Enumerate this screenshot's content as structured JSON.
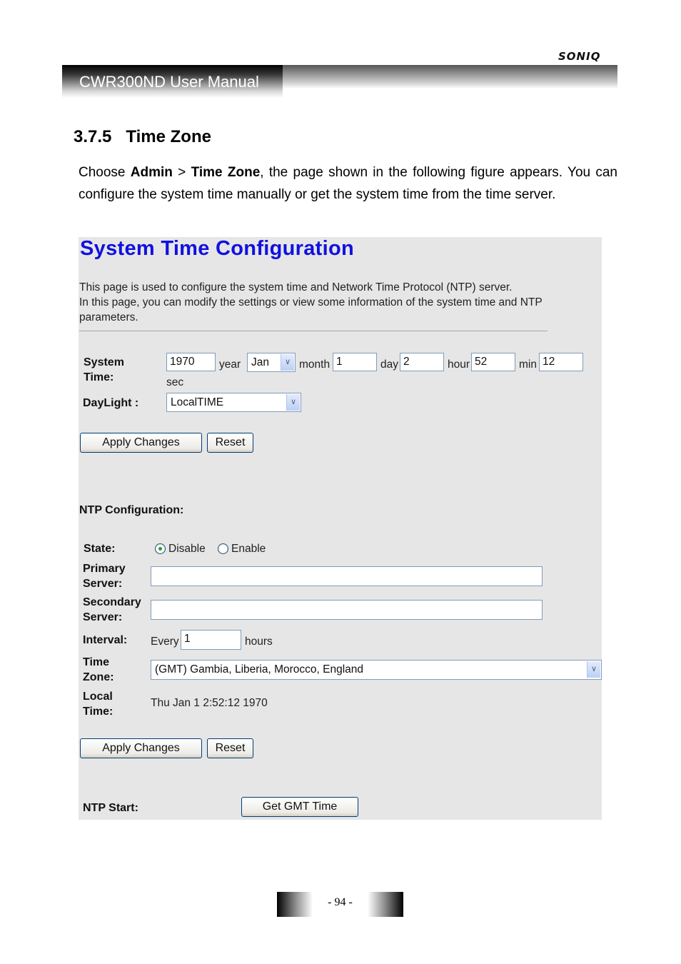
{
  "header": {
    "brand": "SONIQ",
    "manual_title": "CWR300ND User Manual"
  },
  "section": {
    "number": "3.7.5",
    "title": "Time Zone"
  },
  "intro": {
    "prefix": "Choose ",
    "menu_1": "Admin",
    "separator": " > ",
    "menu_2": "Time Zone",
    "suffix": ", the page shown in the following figure appears. You can configure the system time manually or get the system time from the time server."
  },
  "figure": {
    "title": "System Time Configuration",
    "description_line1": "This page is used to configure the system time and Network Time Protocol (NTP) server.",
    "description_line2": "In this page, you can modify the settings or view some information of the system time and NTP parameters.",
    "system_time": {
      "label_line1": "System",
      "label_line2": "Time:",
      "year_value": "1970",
      "year_unit": "year",
      "month_value": "Jan",
      "month_unit": "month",
      "day_value": "1",
      "day_unit": "day",
      "hour_value": "2",
      "hour_unit": "hour",
      "min_value": "52",
      "min_unit": "min",
      "sec_value": "12",
      "sec_unit": "sec"
    },
    "daylight": {
      "label": "DayLight :",
      "value": "LocalTIME"
    },
    "buttons": {
      "apply": "Apply Changes",
      "reset": "Reset",
      "get_gmt": "Get GMT Time"
    },
    "ntp": {
      "heading": "NTP Configuration:",
      "state_label": "State:",
      "state_options": [
        "Disable",
        "Enable"
      ],
      "state_selected": "Disable",
      "primary_label_line1": "Primary",
      "primary_label_line2": "Server:",
      "primary_value": "",
      "secondary_label_line1": "Secondary",
      "secondary_label_line2": "Server:",
      "secondary_value": "",
      "interval_label": "Interval:",
      "interval_prefix": "Every",
      "interval_value": "1",
      "interval_unit": "hours",
      "timezone_label_line1": "Time",
      "timezone_label_line2": "Zone:",
      "timezone_value": "(GMT) Gambia, Liberia, Morocco, England",
      "localtime_label_line1": "Local",
      "localtime_label_line2": "Time:",
      "localtime_value": "Thu Jan 1 2:52:12 1970",
      "start_label": "NTP Start:"
    }
  },
  "footer": {
    "page_number": "- 94 -"
  }
}
